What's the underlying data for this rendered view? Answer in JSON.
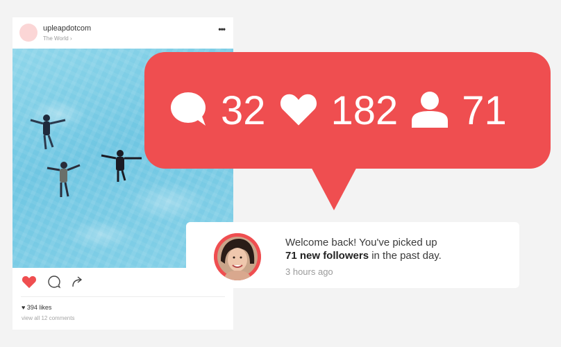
{
  "post": {
    "username": "upleapdotcom",
    "location": "The World",
    "more_label": "•••",
    "likes_text": "394 likes",
    "comments_text": "view all 12 comments"
  },
  "notification": {
    "comments_count": "32",
    "likes_count": "182",
    "followers_count": "71"
  },
  "toast": {
    "message_prefix": "Welcome back! You've picked up",
    "highlight": "71 new followers",
    "message_suffix": "in the past day.",
    "time": "3 hours ago"
  },
  "colors": {
    "accent": "#ef4e50",
    "water": "#7fcbe6"
  },
  "icons": [
    "comment-bubble-icon",
    "heart-icon",
    "user-icon",
    "share-icon",
    "chevron-right-icon"
  ]
}
